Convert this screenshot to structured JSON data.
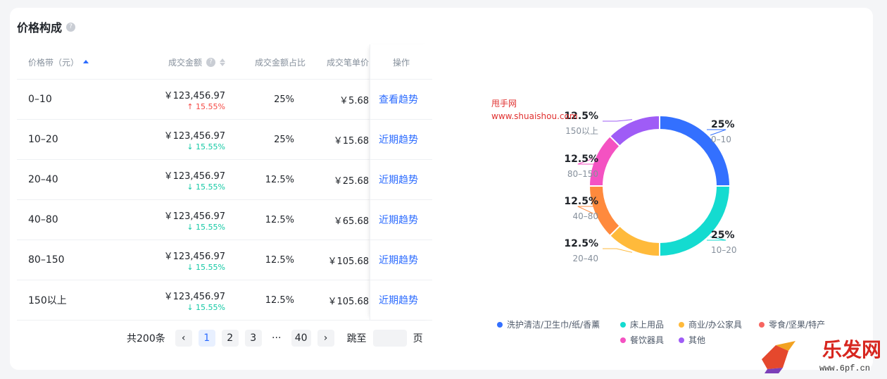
{
  "section": {
    "title": "价格构成"
  },
  "table": {
    "headers": {
      "range": "价格带（元）",
      "amount": "成交金额",
      "share": "成交金额占比",
      "unit": "成交笔单价",
      "op": "操作"
    },
    "rows": [
      {
        "range": "0–10",
        "amount": "￥123,456.97",
        "change": "15.55%",
        "direction": "up",
        "share": "25%",
        "unit": "￥5.68",
        "op": "查看趋势"
      },
      {
        "range": "10–20",
        "amount": "￥123,456.97",
        "change": "15.55%",
        "direction": "down",
        "share": "25%",
        "unit": "￥15.68",
        "op": "近期趋势"
      },
      {
        "range": "20–40",
        "amount": "￥123,456.97",
        "change": "15.55%",
        "direction": "down",
        "share": "12.5%",
        "unit": "￥25.68",
        "op": "近期趋势"
      },
      {
        "range": "40–80",
        "amount": "￥123,456.97",
        "change": "15.55%",
        "direction": "down",
        "share": "12.5%",
        "unit": "￥65.68",
        "op": "近期趋势"
      },
      {
        "range": "80–150",
        "amount": "￥123,456.97",
        "change": "15.55%",
        "direction": "down",
        "share": "12.5%",
        "unit": "￥105.68",
        "op": "近期趋势"
      },
      {
        "range": "150以上",
        "amount": "￥123,456.97",
        "change": "15.55%",
        "direction": "down",
        "share": "12.5%",
        "unit": "￥105.68",
        "op": "近期趋势"
      }
    ]
  },
  "pagination": {
    "total": "共200条",
    "pages": [
      "1",
      "2",
      "3",
      "···",
      "40"
    ],
    "current": "1",
    "jump_label": "跳至",
    "page_suffix": "页"
  },
  "chart_data": {
    "type": "pie",
    "donut": true,
    "slices": [
      {
        "label": "0–10",
        "value": 25,
        "pct": "25%",
        "color": "#3370ff"
      },
      {
        "label": "10–20",
        "value": 25,
        "pct": "25%",
        "color": "#14dbd0"
      },
      {
        "label": "20–40",
        "value": 12.5,
        "pct": "12.5%",
        "color": "#ffba3b"
      },
      {
        "label": "40–80",
        "value": 12.5,
        "pct": "12.5%",
        "color": "#ff8a3d"
      },
      {
        "label": "80–150",
        "value": 12.5,
        "pct": "12.5%",
        "color": "#f452c2"
      },
      {
        "label": "150以上",
        "value": 12.5,
        "pct": "12.5%",
        "color": "#9f5cf6"
      }
    ],
    "legend": [
      {
        "name": "洗护清洁/卫生巾/纸/香薰",
        "color": "#3370ff"
      },
      {
        "name": "床上用品",
        "color": "#14dbd0"
      },
      {
        "name": "商业/办公家具",
        "color": "#ffba3b"
      },
      {
        "name": "零食/坚果/特产",
        "color": "#f76560"
      },
      {
        "name": "餐饮器具",
        "color": "#f452c2"
      },
      {
        "name": "其他",
        "color": "#9f5cf6"
      }
    ]
  },
  "watermark": {
    "line1": "甩手网",
    "line2": "www.shuaishou.com"
  },
  "logo": {
    "text": "乐发网",
    "url": "www.6pf.cn"
  },
  "icons": {
    "help": "help-circle-icon",
    "sort": "sort-icon",
    "prev": "chevron-left-icon",
    "next": "chevron-right-icon"
  }
}
